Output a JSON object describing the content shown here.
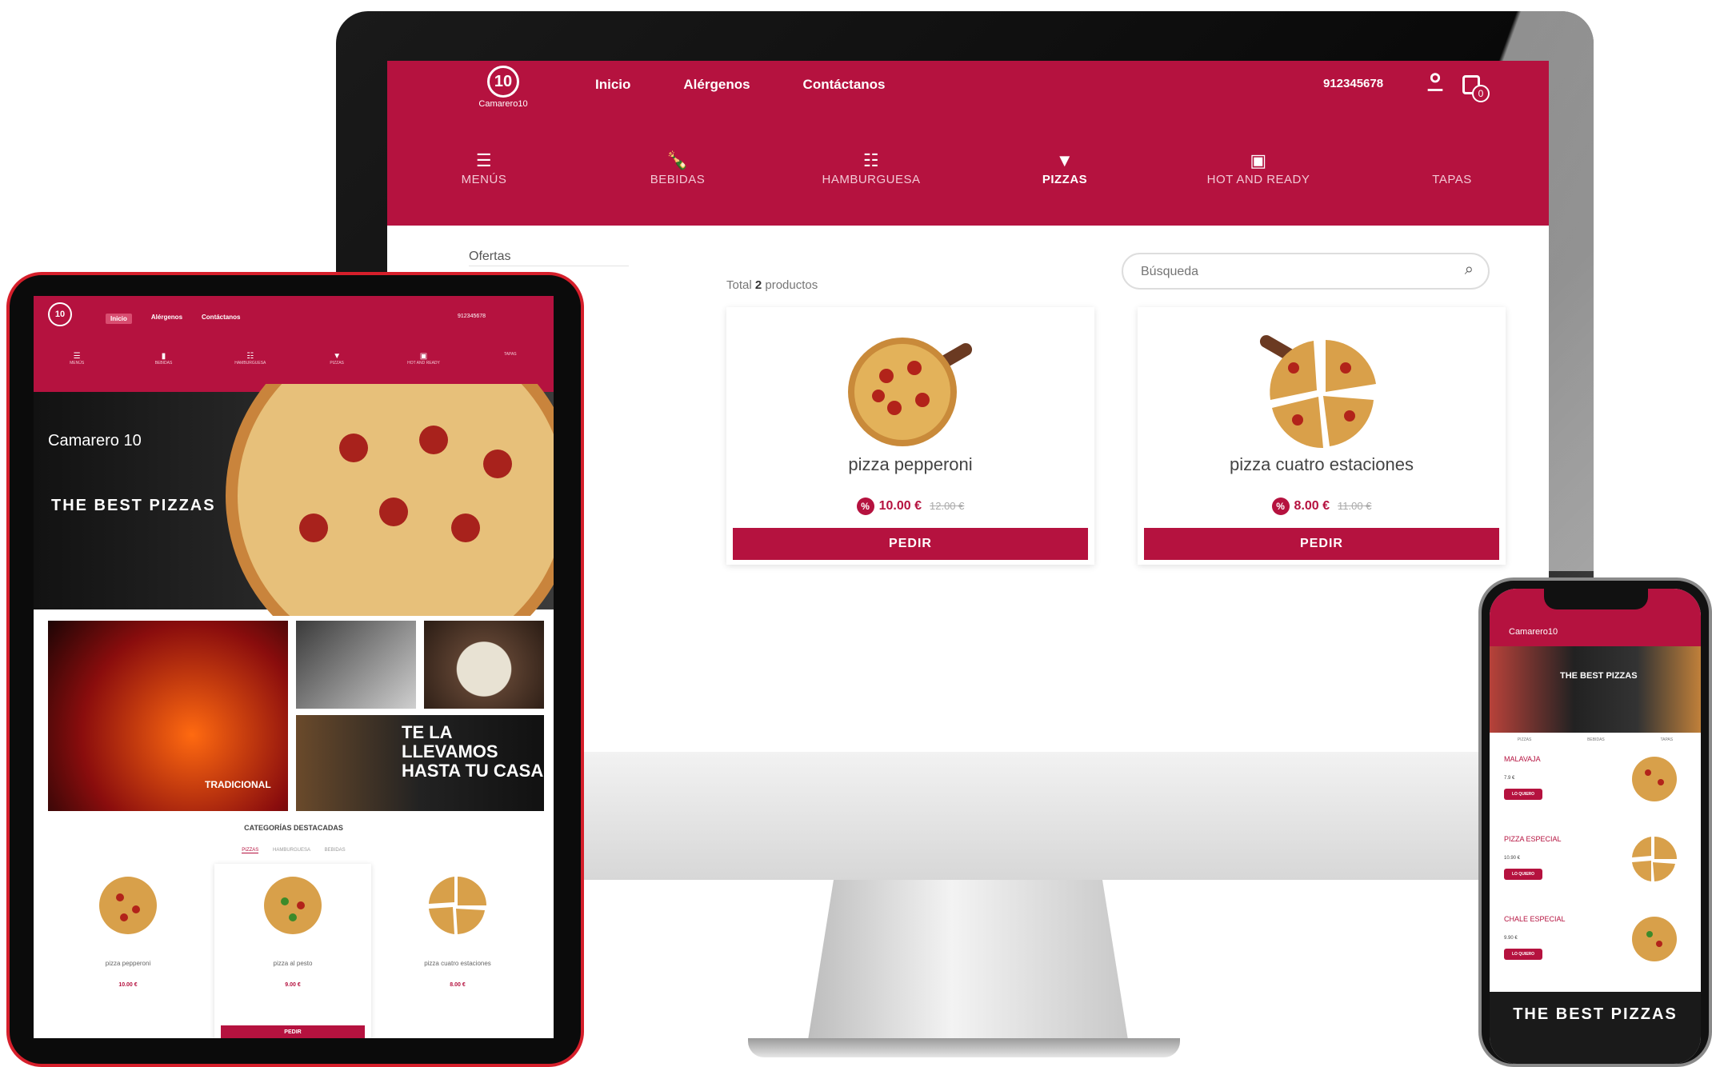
{
  "desktop": {
    "brand": {
      "number": "10",
      "name": "Camarero10"
    },
    "nav": [
      "Inicio",
      "Alérgenos",
      "Contáctanos"
    ],
    "phone": "912345678",
    "cart_count": "0",
    "categories": [
      {
        "icon": "menu-list-icon",
        "label": "MENÚS"
      },
      {
        "icon": "bottle-icon",
        "label": "BEBIDAS"
      },
      {
        "icon": "burger-icon",
        "label": "HAMBURGUESA"
      },
      {
        "icon": "pizza-icon",
        "label": "PIZZAS"
      },
      {
        "icon": "box-icon",
        "label": "HOT AND READY"
      },
      {
        "icon": "",
        "label": "TAPAS"
      }
    ],
    "active_category": "PIZZAS",
    "sidebar_title": "Ofertas",
    "total_prefix": "Total",
    "total_count": "2",
    "total_suffix": "productos",
    "search_placeholder": "Búsqueda",
    "products": [
      {
        "name": "pizza pepperoni",
        "price": "10.00 €",
        "old_price": "12.00 €",
        "button": "PEDIR"
      },
      {
        "name": "pizza cuatro estaciones",
        "price": "8.00 €",
        "old_price": "11.00 €",
        "button": "PEDIR"
      }
    ]
  },
  "tablet": {
    "brand": "Camarero 10",
    "hero_text": "THE BEST PIZZAS",
    "tile_label": "TRADICIONAL",
    "promo_text": "TE LA LLEVAMOS HASTA TU CASA",
    "featured_title": "CATEGORÍAS DESTACADAS",
    "products": [
      {
        "name": "pizza pepperoni",
        "price": "10.00 €"
      },
      {
        "name": "pizza al pesto",
        "price": "9.00 €"
      },
      {
        "name": "pizza cuatro estaciones",
        "price": "8.00 €"
      }
    ],
    "button": "PEDIR"
  },
  "phone": {
    "brand": "Camarero10",
    "hero_text": "THE BEST PIZZAS",
    "items": [
      {
        "name": "MALAVAJA",
        "price": "7.9 €",
        "button": "LO QUIERO"
      },
      {
        "name": "PIZZA ESPECIAL",
        "price": "10.90 €",
        "button": "LO QUIERO"
      },
      {
        "name": "CHALE ESPECIAL",
        "price": "9.90 €",
        "button": "LO QUIERO"
      }
    ],
    "footer_text": "THE BEST PIZZAS"
  },
  "colors": {
    "brand": "#b5123f",
    "tablet_frame": "#d61f2b"
  }
}
